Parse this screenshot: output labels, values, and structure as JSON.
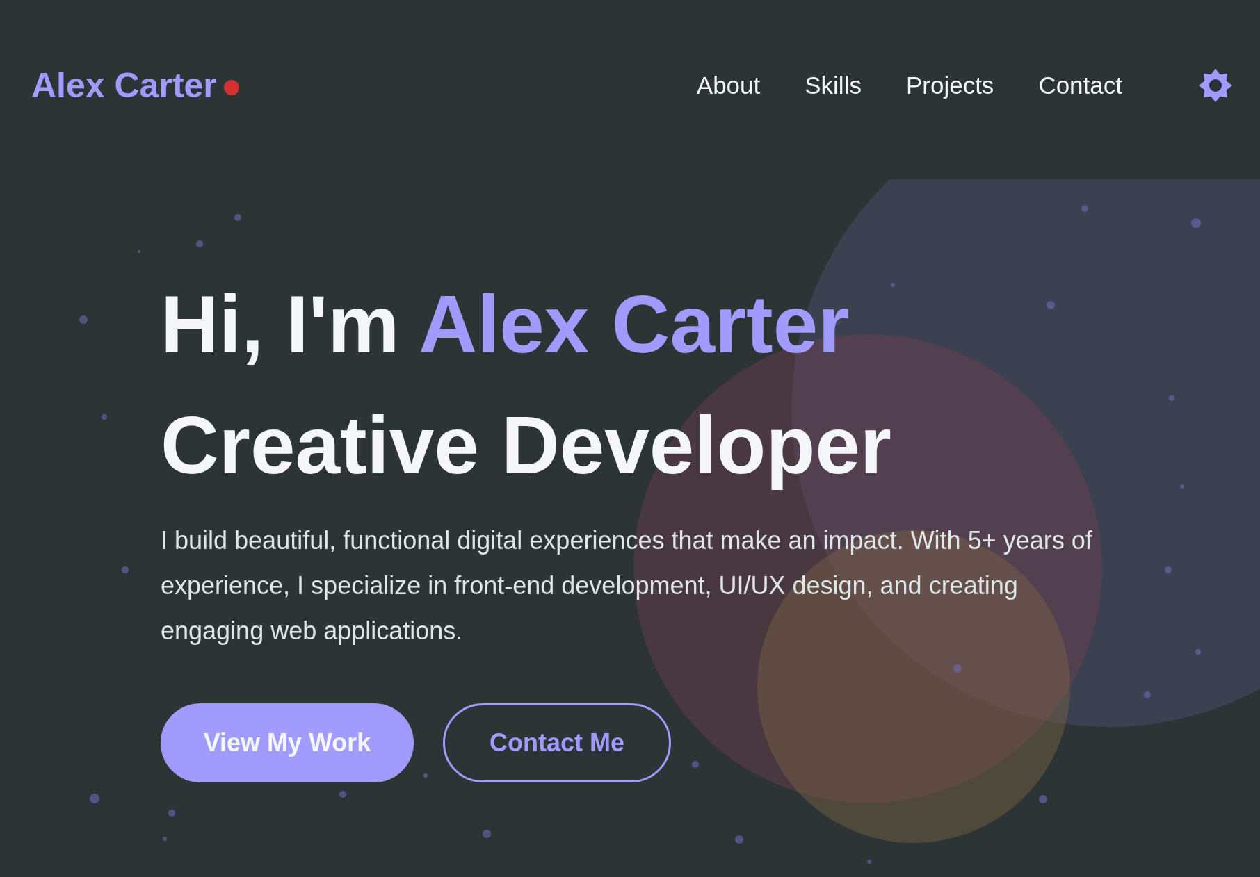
{
  "logo": {
    "text": "Alex Carter"
  },
  "nav": [
    {
      "label": "About"
    },
    {
      "label": "Skills"
    },
    {
      "label": "Projects"
    },
    {
      "label": "Contact"
    }
  ],
  "hero": {
    "greeting": "Hi, I'm",
    "name": "Alex Carter",
    "title": "Creative Developer",
    "description": "I build beautiful, functional digital experiences that make an impact. With 5+ years of experience, I specialize in front-end development, UI/UX design, and creating engaging web applications.",
    "buttons": [
      {
        "label": "View My Work",
        "kind": "primary"
      },
      {
        "label": "Contact Me",
        "kind": "outline"
      }
    ]
  }
}
